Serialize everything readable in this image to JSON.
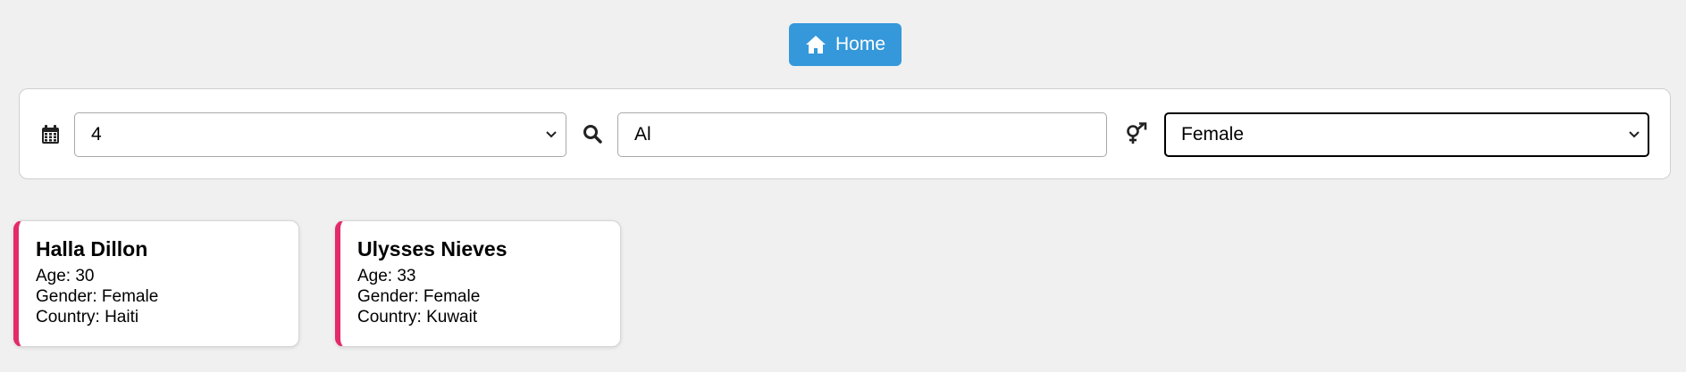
{
  "header": {
    "home_label": "Home"
  },
  "filters": {
    "age": {
      "icon": "calendar-icon",
      "selected": "4"
    },
    "search": {
      "icon": "search-icon",
      "value": "Al"
    },
    "gender": {
      "icon": "gender-icon",
      "selected": "Female"
    }
  },
  "cards": [
    {
      "name": "Halla Dillon",
      "age": "Age: 30",
      "gender": "Gender: Female",
      "country": "Country: Haiti"
    },
    {
      "name": "Ulysses Nieves",
      "age": "Age: 33",
      "gender": "Gender: Female",
      "country": "Country: Kuwait"
    }
  ],
  "colors": {
    "home_button": "#3498db",
    "card_accent": "#e32a6a",
    "background": "#f0f0f0"
  }
}
